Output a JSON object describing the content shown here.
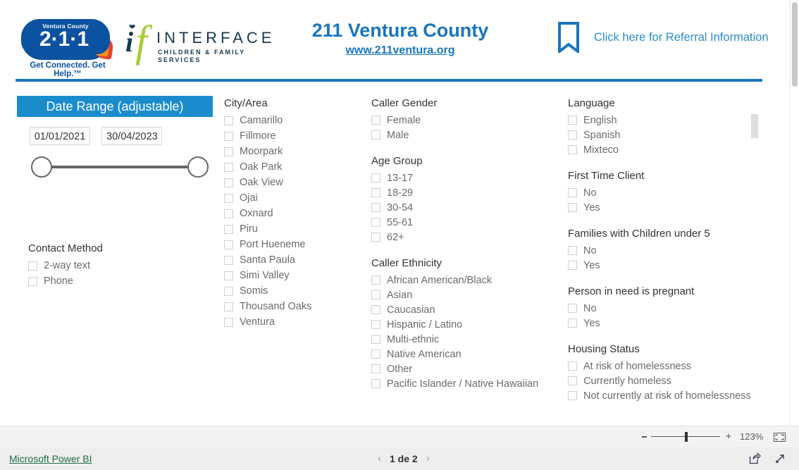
{
  "header": {
    "logo_211": {
      "county": "Ventura County",
      "number": "2·1·1",
      "tagline": "Get Connected. Get Help.™"
    },
    "logo_interface": {
      "mark_i": "i",
      "mark_f": "f",
      "word": "INTERFACE",
      "subtitle": "CHILDREN & FAMILY SERVICES"
    },
    "title": "211 Ventura County",
    "url": "www.211ventura.org",
    "referral_link": "Click here for Referral Information"
  },
  "date_range": {
    "header": "Date Range (adjustable)",
    "start": "01/01/2021",
    "end": "30/04/2023"
  },
  "contact_method": {
    "title": "Contact Method",
    "items": [
      "2-way text",
      "Phone"
    ]
  },
  "city_area": {
    "title": "City/Area",
    "items": [
      "Camarillo",
      "Fillmore",
      "Moorpark",
      "Oak Park",
      "Oak View",
      "Ojai",
      "Oxnard",
      "Piru",
      "Port Hueneme",
      "Santa Paula",
      "Simi Valley",
      "Somis",
      "Thousand Oaks",
      "Ventura"
    ]
  },
  "caller_gender": {
    "title": "Caller Gender",
    "items": [
      "Female",
      "Male"
    ]
  },
  "age_group": {
    "title": "Age Group",
    "items": [
      "13-17",
      "18-29",
      "30-54",
      "55-61",
      "62+"
    ]
  },
  "caller_ethnicity": {
    "title": "Caller Ethnicity",
    "items": [
      "African American/Black",
      "Asian",
      "Caucasian",
      "Hispanic / Latino",
      "Multi-ethnic",
      "Native American",
      "Other",
      "Pacific Islander / Native Hawaiian"
    ]
  },
  "language": {
    "title": "Language",
    "items": [
      "English",
      "Spanish",
      "Mixteco"
    ]
  },
  "first_time_client": {
    "title": "First Time Client",
    "items": [
      "No",
      "Yes"
    ]
  },
  "families_children": {
    "title": "Families with Children under 5",
    "items": [
      "No",
      "Yes"
    ]
  },
  "pregnant": {
    "title": "Person in need is pregnant",
    "items": [
      "No",
      "Yes"
    ]
  },
  "housing_status": {
    "title": "Housing Status",
    "items": [
      "At risk of homelessness",
      "Currently homeless",
      "Not currently at risk of homelessness"
    ]
  },
  "zoombar": {
    "minus_label": "-",
    "plus_label": "+",
    "zoom_level": "123%"
  },
  "bottombar": {
    "powerbi_label": "Microsoft Power BI",
    "prev_arrow": "‹",
    "page_text": "1 de 2",
    "next_arrow": "›"
  },
  "colors": {
    "brand_blue": "#1a75bb",
    "header_blue": "#1a8ccc",
    "logo_navy": "#0b52a0",
    "interface_green": "#a8cc3a",
    "interface_navy": "#17394f",
    "powerbi_green": "#1f6f4a"
  }
}
